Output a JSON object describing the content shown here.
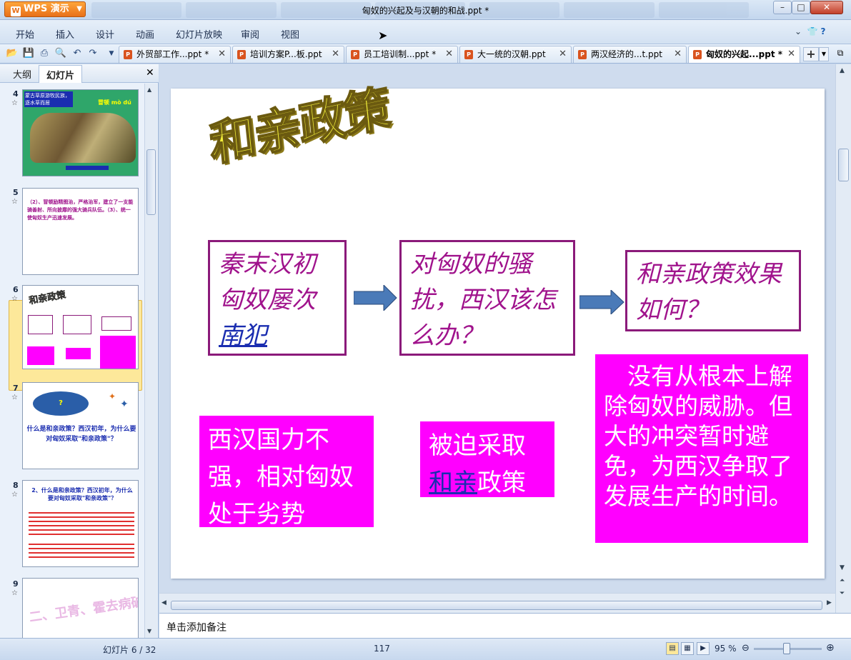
{
  "app": {
    "name": "WPS 演示",
    "window_title": "匈奴的兴起及与汉朝的和战.ppt *"
  },
  "menu": [
    "开始",
    "插入",
    "设计",
    "动画",
    "幻灯片放映",
    "审阅",
    "视图"
  ],
  "tabs": [
    {
      "label": "外贸部工作...ppt *"
    },
    {
      "label": "培训方案P...板.ppt"
    },
    {
      "label": "员工培训制...ppt *"
    },
    {
      "label": "大一统的汉朝.ppt"
    },
    {
      "label": "两汉经济的...t.ppt"
    },
    {
      "label": "匈奴的兴起...ppt *"
    }
  ],
  "left_pane": {
    "outline_tab": "大纲",
    "slides_tab": "幻灯片"
  },
  "thumbnails": [
    {
      "num": "4",
      "caption1": "蒙古草原游牧民族，逐水草而居",
      "caption2": "冒顿 mò dú"
    },
    {
      "num": "5",
      "text": "（2）、冒顿励精图治，严格治军，建立了一支能骑善射、所向披靡的强大骑兵队伍。（3）、统一使匈奴生产迅速发展。"
    },
    {
      "num": "6"
    },
    {
      "num": "7",
      "title": "什么是和亲政策？西汉初年，为什么要对匈奴采取\"和亲政策\"？"
    },
    {
      "num": "8",
      "title": "2、什么是和亲政策？西汉初年，为什么要对匈奴采取\"和亲政策\"？"
    },
    {
      "num": "9",
      "title": "二、卫青、霍去病破匈奴"
    }
  ],
  "slide": {
    "wordart": "和亲政策",
    "box1_line1": "秦末汉初",
    "box1_line2": "匈奴屡次",
    "box1_link": "南犯",
    "box2": "对匈奴的骚扰，西汉该怎么办？",
    "box3": "和亲政策效果如何？",
    "pink1": "西汉国力不强，相对匈奴处于劣势",
    "pink2_line1": "被迫采取",
    "pink2_link": "和亲",
    "pink2_rest": "政策",
    "pink3": "没有从根本上解除匈奴的威胁。但大的冲突暂时避免，为西汉争取了发展生产的时间。"
  },
  "notes_placeholder": "单击添加备注",
  "status": {
    "slide_indicator": "幻灯片 6 / 32",
    "middle": "117",
    "zoom": "95 %"
  },
  "colors": {
    "accent_magenta": "#ff00ff",
    "box_border": "#8b1a7a",
    "text_magenta": "#a0138c",
    "arrow_blue": "#4a7ab8"
  }
}
